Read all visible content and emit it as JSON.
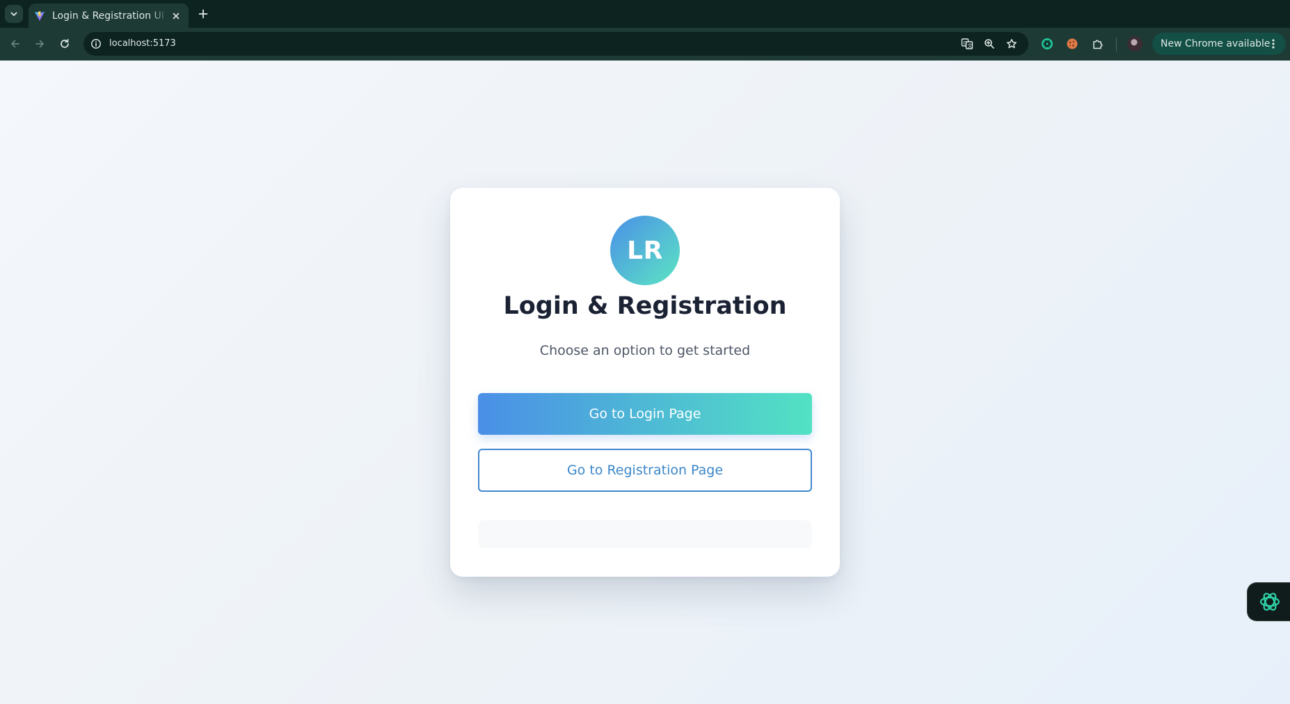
{
  "browser": {
    "tab": {
      "title": "Login & Registration UI S",
      "favicon": "vite-icon"
    },
    "address_bar": {
      "url": "localhost:5173"
    },
    "update_pill": {
      "label": "New Chrome available"
    },
    "icons": {
      "tab_search": "chevron-down-icon",
      "tab_close": "close-icon",
      "new_tab": "plus-icon",
      "back": "arrow-left-icon",
      "forward": "arrow-right-icon",
      "reload": "reload-icon",
      "site_info": "info-icon",
      "translate": "translate-icon",
      "zoom": "zoom-icon",
      "bookmark": "star-icon",
      "extension_1": "chatgpt-extension-icon",
      "extension_2": "cookie-extension-icon",
      "extensions_menu": "puzzle-icon",
      "profile": "profile-avatar",
      "menu": "kebab-menu-icon"
    }
  },
  "page": {
    "logo_text": "LR",
    "title": "Login & Registration",
    "subtitle": "Choose an option to get started",
    "login_button": "Go to Login Page",
    "register_button": "Go to Registration Page",
    "assistant_icon": "openai-assistant-icon"
  },
  "colors": {
    "gradient_start": "#4a8fe7",
    "gradient_end": "#52e2c3",
    "secondary_border": "#3f86cf",
    "title_text": "#1a2233",
    "browser_frame": "#0d2320"
  }
}
